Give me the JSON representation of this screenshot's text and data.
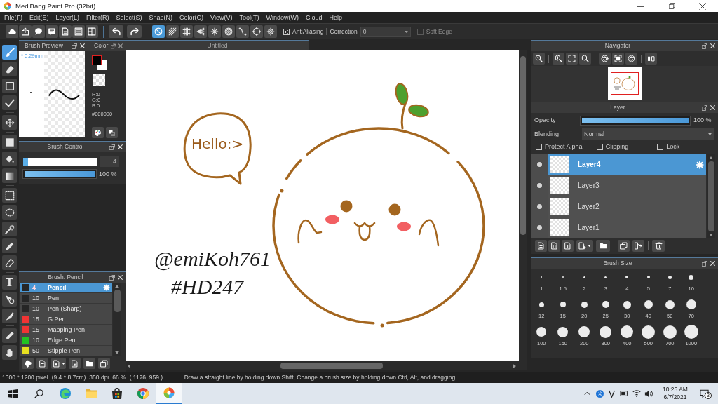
{
  "window": {
    "title": "MediBang Paint Pro (32bit)"
  },
  "menu": [
    "File(F)",
    "Edit(E)",
    "Layer(L)",
    "Filter(R)",
    "Select(S)",
    "Snap(N)",
    "Color(C)",
    "View(V)",
    "Tool(T)",
    "Window(W)",
    "Cloud",
    "Help"
  ],
  "toolbar": {
    "snap_modes": [
      {
        "selected": true
      },
      {
        "selected": false
      },
      {
        "selected": false
      },
      {
        "selected": false
      },
      {
        "selected": false
      },
      {
        "selected": false
      },
      {
        "selected": false
      },
      {
        "selected": false
      },
      {
        "selected": false
      }
    ],
    "antialiasing": {
      "label": "AntiAliasing",
      "checked": true
    },
    "correction": {
      "label": "Correction",
      "value": "0"
    },
    "soft_edge": {
      "label": "Soft Edge",
      "checked": false,
      "disabled": true
    }
  },
  "tools": [
    {
      "selected": true
    },
    {
      "selected": false
    },
    {
      "selected": false
    },
    {
      "selected": false
    },
    {
      "selected": false
    },
    {
      "selected": false
    },
    {
      "selected": false
    },
    {
      "selected": false
    },
    {
      "selected": false
    },
    {
      "selected": false
    },
    {
      "selected": false
    },
    {
      "selected": false
    },
    {
      "selected": false
    },
    {
      "selected": false,
      "glyph": "T"
    },
    {
      "selected": false
    },
    {
      "selected": false
    },
    {
      "selected": false
    },
    {
      "selected": false
    }
  ],
  "brush_preview": {
    "title": "Brush Preview",
    "size": "* 0.29mm"
  },
  "color": {
    "title": "Color",
    "swatches": [
      {
        "color": "#000000",
        "selected": true
      },
      {
        "color": "#ffffff",
        "selected": false
      }
    ],
    "channels": [
      "R:0",
      "G:0",
      "B:0"
    ],
    "hex": "#000000"
  },
  "brush_control": {
    "title": "Brush Control",
    "size": {
      "value": "4",
      "level": 0.07
    },
    "opacity": {
      "value": "100 %",
      "level": 1
    }
  },
  "brush_list": {
    "title": "Brush: Pencil",
    "items": [
      {
        "size": "4",
        "name": "Pencil",
        "color": "#262626",
        "selected": true
      },
      {
        "size": "10",
        "name": "Pen",
        "color": "#262626",
        "selected": false
      },
      {
        "size": "10",
        "name": "Pen (Sharp)",
        "color": "#262626",
        "selected": false
      },
      {
        "size": "15",
        "name": "G Pen",
        "color": "#f03434",
        "selected": false
      },
      {
        "size": "15",
        "name": "Mapping Pen",
        "color": "#f03434",
        "selected": false
      },
      {
        "size": "10",
        "name": "Edge Pen",
        "color": "#22c322",
        "selected": false
      },
      {
        "size": "50",
        "name": "Stipple Pen",
        "color": "#e8e020",
        "selected": false
      }
    ]
  },
  "document": {
    "tab": "Untitled",
    "canvas_texts": [
      "Hello:>",
      "@emiKoh761",
      "#HD247"
    ]
  },
  "navigator": {
    "title": "Navigator"
  },
  "layer_panel": {
    "title": "Layer",
    "opacity": {
      "label": "Opacity",
      "value": "100 %",
      "level": 1
    },
    "blending": {
      "label": "Blending",
      "value": "Normal"
    },
    "options": [
      {
        "label": "Protect Alpha",
        "checked": false
      },
      {
        "label": "Clipping",
        "checked": false
      },
      {
        "label": "Lock",
        "checked": false
      }
    ],
    "layers": [
      {
        "name": "Layer4",
        "selected": true
      },
      {
        "name": "Layer3",
        "selected": false
      },
      {
        "name": "Layer2",
        "selected": false
      },
      {
        "name": "Layer1",
        "selected": false
      }
    ]
  },
  "brush_size": {
    "title": "Brush Size",
    "sizes": [
      "1",
      "1.5",
      "2",
      "3",
      "4",
      "5",
      "7",
      "10",
      "12",
      "15",
      "20",
      "25",
      "30",
      "40",
      "50",
      "70",
      "100",
      "150",
      "200",
      "300",
      "400",
      "500",
      "700",
      "1000"
    ]
  },
  "status_bar": {
    "image_size": "1300 * 1200 pixel",
    "print_size": "(9.4 * 8.7cm)",
    "resolution": "350 dpi",
    "zoom": "66 %",
    "cursor": "( 1176, 959 )",
    "hint": "Draw a straight line by holding down Shift, Change a brush size by holding down Ctrl, Alt, and dragging"
  },
  "taskbar": {
    "apps": [
      {
        "selected": false
      },
      {
        "selected": false
      },
      {
        "selected": false
      },
      {
        "selected": false
      },
      {
        "selected": true
      }
    ],
    "time": "10:25 AM",
    "date": "6/7/2021",
    "notifications": "3"
  }
}
